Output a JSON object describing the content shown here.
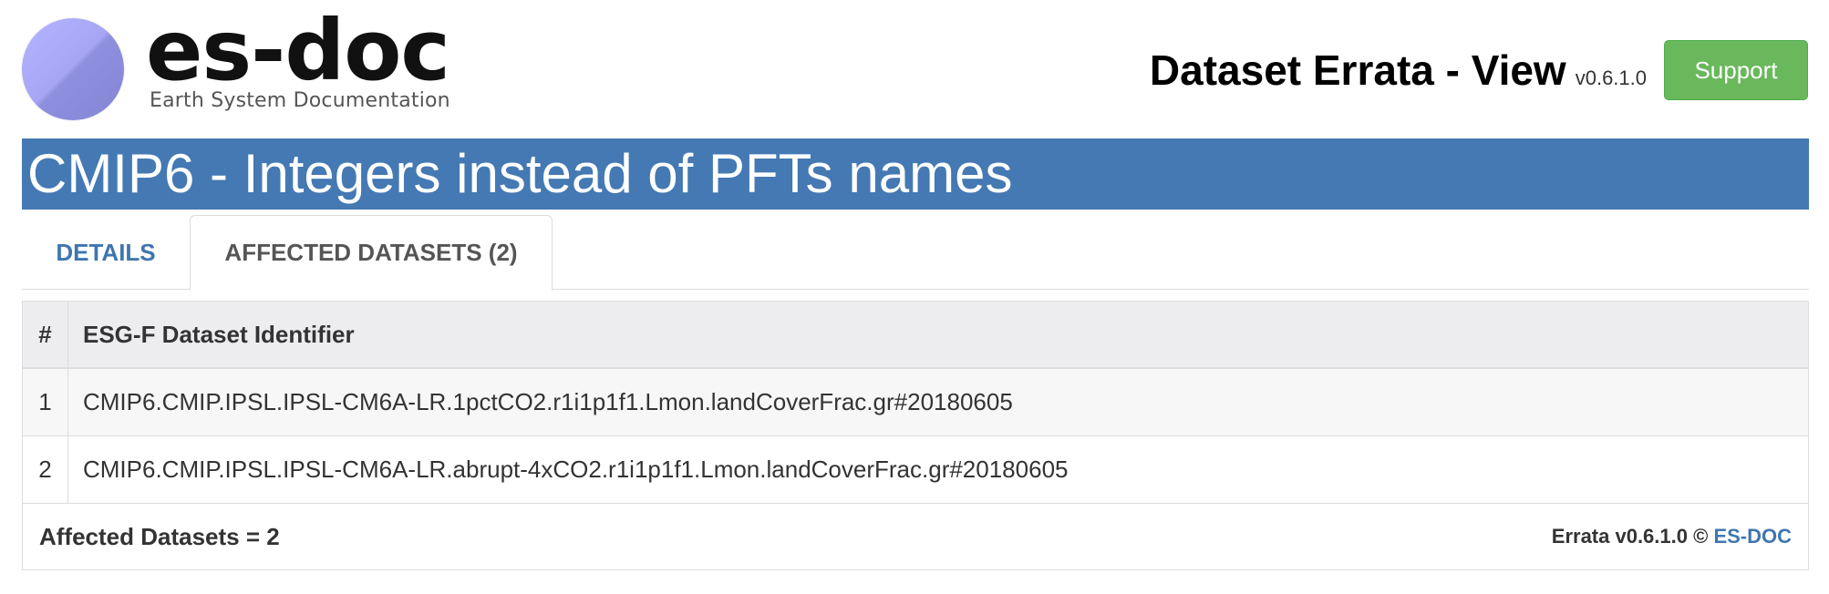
{
  "header": {
    "logo": {
      "wordmark": "es-doc",
      "tagline": "Earth System Documentation"
    },
    "page_title": "Dataset Errata - View",
    "version": "v0.6.1.0",
    "support_label": "Support"
  },
  "banner": {
    "title": "CMIP6 - Integers instead of PFTs names"
  },
  "tabs": [
    {
      "label": "DETAILS",
      "active": false
    },
    {
      "label": "AFFECTED DATASETS (2)",
      "active": true
    }
  ],
  "table": {
    "columns": [
      "#",
      "ESG-F Dataset Identifier"
    ],
    "rows": [
      {
        "index": "1",
        "identifier": "CMIP6.CMIP.IPSL.IPSL-CM6A-LR.1pctCO2.r1i1p1f1.Lmon.landCoverFrac.gr#20180605"
      },
      {
        "index": "2",
        "identifier": "CMIP6.CMIP.IPSL.IPSL-CM6A-LR.abrupt-4xCO2.r1i1p1f1.Lmon.landCoverFrac.gr#20180605"
      }
    ],
    "footer": {
      "count_text": "Affected Datasets = 2",
      "credit_prefix": "Errata v0.6.1.0 ©",
      "credit_link": "ES-DOC"
    }
  },
  "colors": {
    "banner_bg": "#4479b3",
    "support_bg": "#6ab85c",
    "link": "#3f76b0"
  }
}
